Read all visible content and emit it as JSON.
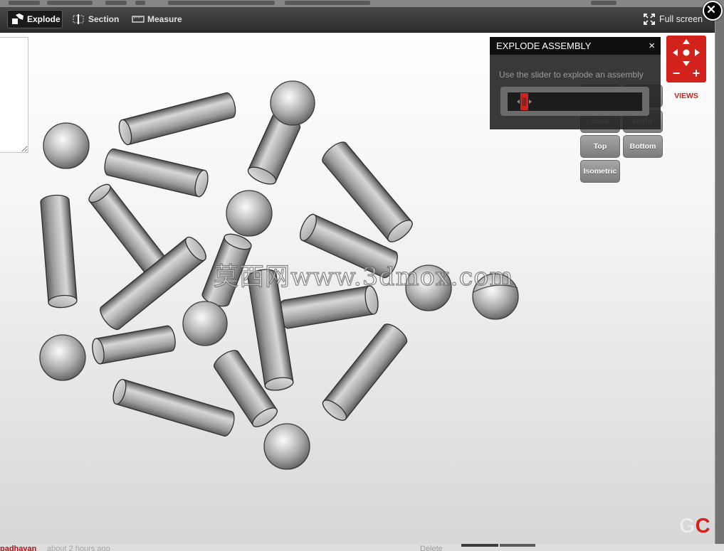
{
  "toolbar": {
    "explode_label": "Explode",
    "section_label": "Section",
    "measure_label": "Measure",
    "fullscreen_label": "Full screen"
  },
  "explode_panel": {
    "title": "EXPLODE ASSEMBLY",
    "close_glyph": "×",
    "hint": "Use the slider to explode an assembly",
    "slider_value": 0.1
  },
  "views": {
    "back": "Back",
    "right": "Right",
    "top": "Top",
    "bottom": "Bottom",
    "isometric": "Isometric",
    "label": "VIEWS",
    "zoom_out_glyph": "−",
    "zoom_in_glyph": "+"
  },
  "watermark": {
    "text": "莫西网www.3dmox.com"
  },
  "logo": {
    "g": "G",
    "c": "C"
  },
  "background_page": {
    "author": "padhavan",
    "time": "about 2 hours ago",
    "delete_label": "Delete"
  },
  "icons": {
    "explode": "explode-icon",
    "section": "section-icon",
    "measure": "ruler-icon",
    "fullscreen": "fullscreen-icon",
    "close_viewer": "close-icon",
    "pan": "arrow-icons"
  },
  "colors": {
    "accent": "#d3221c",
    "toolbar_background": "#363636",
    "panel_header": "#0f0f0f"
  }
}
